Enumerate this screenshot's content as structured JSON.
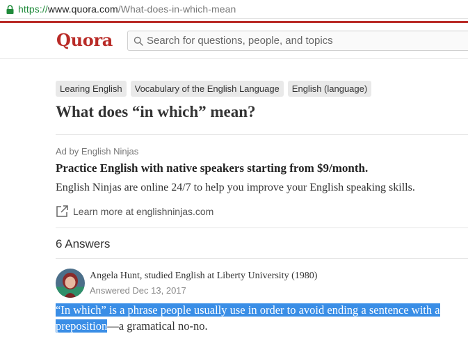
{
  "browser": {
    "url_scheme": "https://",
    "url_host": "www.quora.com",
    "url_path": "/What-does-in-which-mean"
  },
  "header": {
    "logo": "Quora",
    "search_placeholder": "Search for questions, people, and topics"
  },
  "topics": [
    "Learing English",
    "Vocabulary of the English Language",
    "English (language)"
  ],
  "question": {
    "title": "What does “in which” mean?"
  },
  "ad": {
    "label": "Ad by English Ninjas",
    "title": "Practice English with native speakers starting from $9/month.",
    "text": "English Ninjas are online 24/7 to help you improve your English speaking skills.",
    "link": "Learn more at englishninjas.com"
  },
  "answers": {
    "count_label": "6 Answers",
    "first": {
      "author": "Angela Hunt, studied English at Liberty University (1980)",
      "date": "Answered Dec 13, 2017",
      "text_highlighted_line1": "“In which” is a phrase people usually use in order to avoid ending a sentence with a",
      "text_highlighted_line2": "preposition",
      "text_rest": "—a gramatical no-no."
    }
  },
  "colors": {
    "brand": "#b92b27",
    "highlight": "#3a8ee6",
    "secure": "#1f8a3a"
  }
}
